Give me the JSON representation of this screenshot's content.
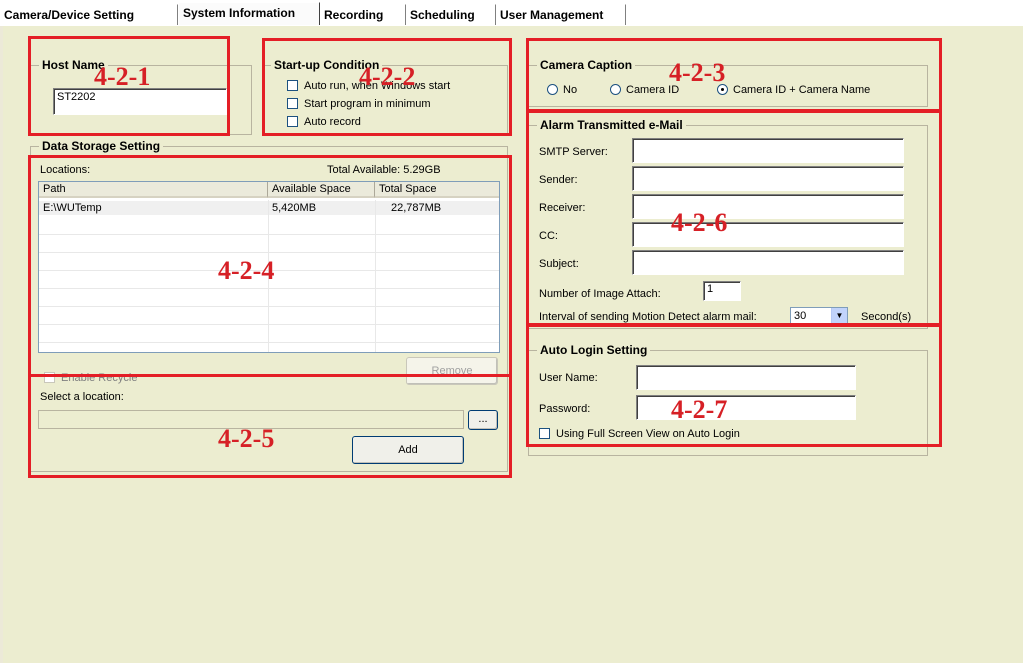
{
  "tabs": [
    "Camera/Device Setting",
    "System Information",
    "Recording",
    "Scheduling",
    "User Management"
  ],
  "active_tab": "System Information",
  "host_name": {
    "title": "Host Name",
    "value": "ST2202"
  },
  "startup": {
    "title": "Start-up Condition",
    "options": [
      "Auto run, when Windows start",
      "Start program in minimum",
      "Auto record"
    ]
  },
  "camera_caption": {
    "title": "Camera Caption",
    "options": [
      "No",
      "Camera ID",
      "Camera ID + Camera Name"
    ],
    "selected": "Camera ID + Camera Name"
  },
  "data_storage": {
    "title": "Data Storage Setting",
    "locations_label": "Locations:",
    "total_available": "Total Available: 5.29GB",
    "columns": [
      "Path",
      "Available Space",
      "Total Space"
    ],
    "rows": [
      {
        "path": "E:\\WUTemp",
        "available": "5,420MB",
        "total": "22,787MB"
      }
    ],
    "remove_label": "Remove",
    "enable_recycle_label": "Enable Recycle",
    "select_location_label": "Select a location:",
    "browse_label": "...",
    "add_label": "Add"
  },
  "email": {
    "title": "Alarm Transmitted e-Mail",
    "smtp_label": "SMTP Server:",
    "sender_label": "Sender:",
    "receiver_label": "Receiver:",
    "cc_label": "CC:",
    "subject_label": "Subject:",
    "attach_label": "Number of Image Attach:",
    "attach_value": "1",
    "interval_label": "Interval of sending Motion Detect alarm mail:",
    "interval_value": "30",
    "interval_unit": "Second(s)"
  },
  "auto_login": {
    "title": "Auto Login Setting",
    "user_label": "User Name:",
    "password_label": "Password:",
    "fullscreen_label": "Using Full Screen View on Auto Login"
  },
  "annotations": [
    "4-2-1",
    "4-2-2",
    "4-2-3",
    "4-2-4",
    "4-2-5",
    "4-2-6",
    "4-2-7"
  ],
  "colors": {
    "annotation": "#e41e26",
    "panel": "#ecedd0"
  }
}
